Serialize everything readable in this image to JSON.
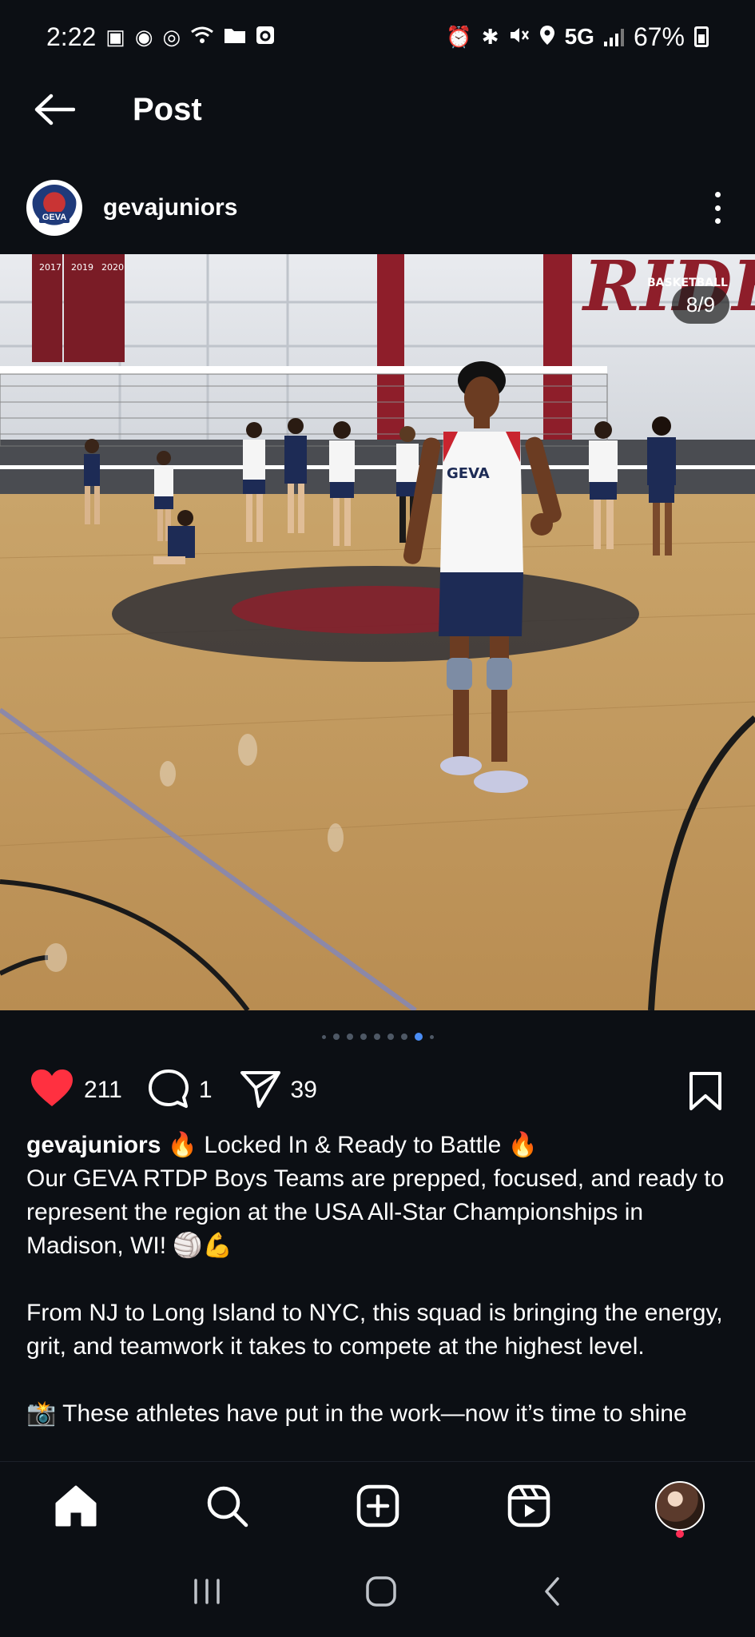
{
  "status_bar": {
    "time": "2:22",
    "network": "5G",
    "battery": "67%",
    "left_icons": [
      "photo-icon",
      "chrome-icon",
      "hotspot-icon",
      "wifi-icon",
      "folder-icon",
      "app-icon"
    ],
    "right_icons": [
      "alarm-icon",
      "bluetooth-icon",
      "mute-icon",
      "location-icon",
      "signal-icon",
      "battery-icon"
    ]
  },
  "header": {
    "title": "Post",
    "back_icon": "arrow-left-icon"
  },
  "post": {
    "username": "gevajuniors",
    "avatar_text": "GEVA",
    "menu_icon": "more-vertical-icon",
    "image": {
      "counter": "8/9",
      "banner_text": "RIDER",
      "banner_sub": "BASKETBALL",
      "years": [
        "2017",
        "2019",
        "2020"
      ],
      "jersey_text": "GEVA",
      "total_slides": 9,
      "active_slide": 8
    },
    "actions": {
      "likes": "211",
      "comments": "1",
      "shares": "39",
      "like_icon": "heart-filled-icon",
      "comment_icon": "comment-icon",
      "share_icon": "send-icon",
      "save_icon": "bookmark-icon"
    },
    "caption": {
      "user": "gevajuniors",
      "line1": " 🔥 Locked In & Ready to Battle 🔥",
      "para1": "Our GEVA RTDP Boys Teams are prepped, focused, and ready to represent the region at the USA All-Star Championships in Madison, WI! 🏐💪",
      "para2": "From NJ to Long Island to NYC, this squad is bringing the energy, grit, and teamwork it takes to compete at the highest level.",
      "para3": "📸 These athletes have put in the work—now it’s time to shine"
    }
  },
  "bottom_nav": [
    "home-icon",
    "search-icon",
    "create-icon",
    "reels-icon",
    "profile-avatar"
  ],
  "system_nav": [
    "recents-icon",
    "home-button-icon",
    "back-icon"
  ],
  "colors": {
    "background": "#0c0f14",
    "like": "#ff3040",
    "active_dot": "#4a8df5"
  }
}
